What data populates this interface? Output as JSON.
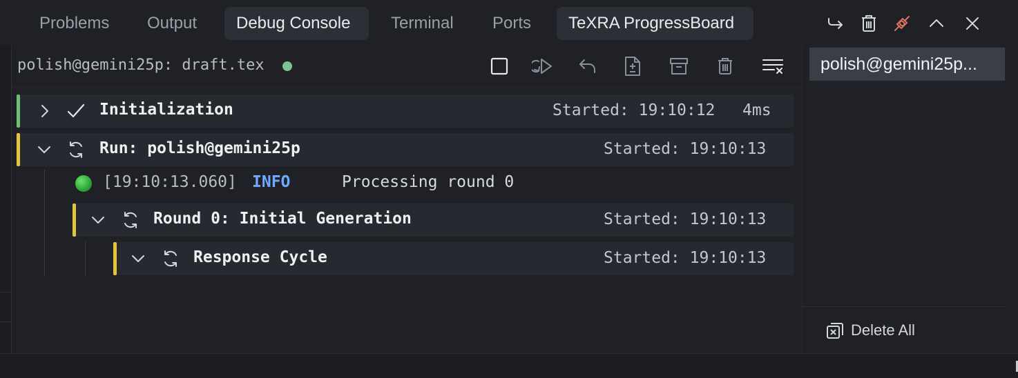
{
  "tabs": [
    {
      "label": "Problems",
      "active": false
    },
    {
      "label": "Output",
      "active": false
    },
    {
      "label": "Debug Console",
      "active": true
    },
    {
      "label": "Terminal",
      "active": false
    },
    {
      "label": "Ports",
      "active": false
    },
    {
      "label": "TeXRA ProgressBoard",
      "active": true
    }
  ],
  "tab_actions": [
    "arrow-return-icon",
    "trash-icon",
    "disconnect-plug-icon",
    "chevron-up-icon",
    "close-icon"
  ],
  "toolbar": {
    "session_label": "polish@gemini25p: draft.tex",
    "status_color": "#7ec48a",
    "tools": [
      "stop-square-icon",
      "restart-icon",
      "undo-icon",
      "diff-file-icon",
      "archive-icon",
      "trash-icon",
      "clear-all-icon"
    ]
  },
  "tree": {
    "initialization": {
      "title": "Initialization",
      "started": "Started: 19:10:12",
      "duration": "4ms",
      "status": "done",
      "bar_color": "#6fbf73"
    },
    "run": {
      "title": "Run: polish@gemini25p",
      "started": "Started: 19:10:13",
      "status": "running",
      "bar_color": "#e2c53d"
    },
    "log": {
      "timestamp": "[19:10:13.060]",
      "level": "INFO",
      "message": "Processing round 0"
    },
    "round": {
      "title": "Round 0: Initial Generation",
      "started": "Started: 19:10:13",
      "status": "running"
    },
    "cycle": {
      "title": "Response Cycle",
      "started": "Started: 19:10:13",
      "status": "running"
    }
  },
  "sidebar": {
    "session_item": "polish@gemini25p...",
    "delete_all": "Delete All"
  },
  "colors": {
    "accent_running": "#e2c53d",
    "accent_done": "#6fbf73",
    "info": "#6ea8ff"
  }
}
